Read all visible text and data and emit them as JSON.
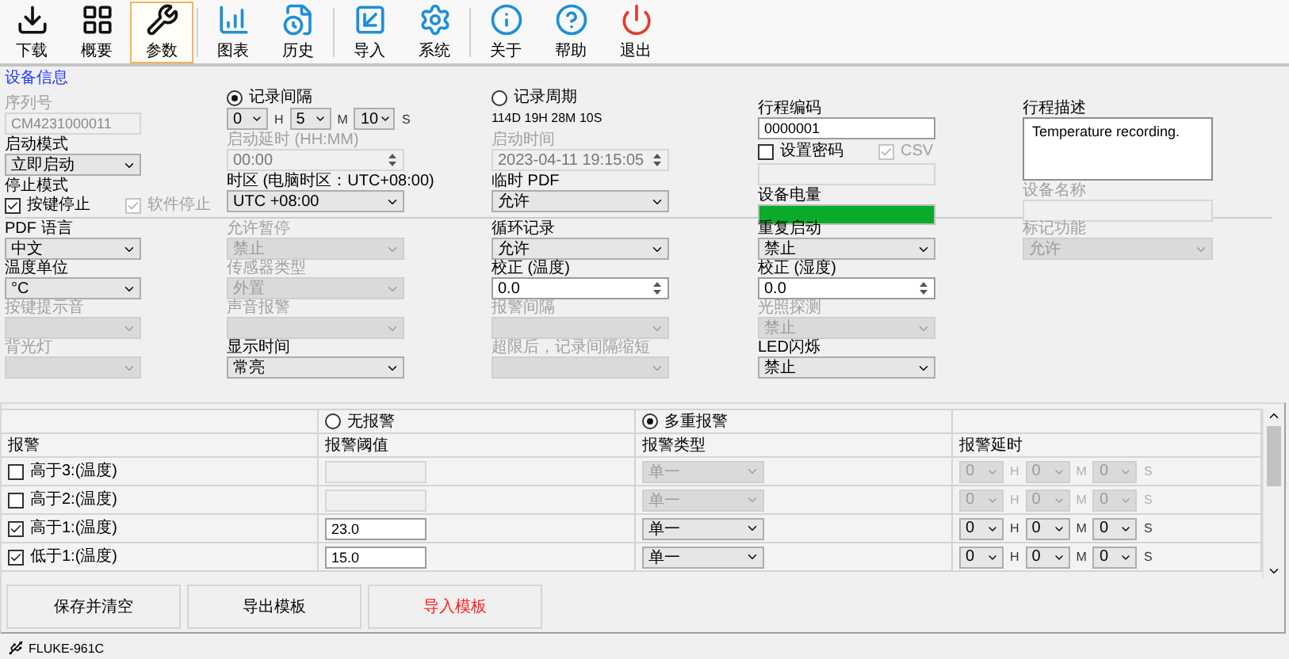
{
  "toolbar": {
    "groups": [
      {
        "buttons": [
          {
            "label": "下载",
            "selected": false
          },
          {
            "label": "概要",
            "selected": false
          },
          {
            "label": "参数",
            "selected": true
          }
        ]
      },
      {
        "buttons": [
          {
            "label": "图表",
            "selected": false
          },
          {
            "label": "历史",
            "selected": false
          }
        ]
      },
      {
        "buttons": [
          {
            "label": "导入",
            "selected": false
          },
          {
            "label": "系统",
            "selected": false
          }
        ]
      },
      {
        "buttons": [
          {
            "label": "关于",
            "selected": false
          },
          {
            "label": "帮助",
            "selected": false
          },
          {
            "label": "退出",
            "selected": false
          }
        ]
      }
    ]
  },
  "section_title": "设备信息",
  "device_info": {
    "columns": [
      {
        "fields": [
          {
            "kind": "text",
            "label": "序列号",
            "value": "CM4231000011",
            "disabled": true
          },
          {
            "kind": "select",
            "label": "启动模式",
            "value": "立即启动",
            "disabled": false
          },
          {
            "kind": "checks",
            "label": "停止模式",
            "options": [
              {
                "label": "按键停止",
                "checked": true,
                "disabled": false
              },
              {
                "label": "软件停止",
                "checked": true,
                "disabled": true
              }
            ]
          }
        ]
      },
      {
        "fields": [
          {
            "kind": "radio-hms",
            "label": "记录间隔",
            "selected": true,
            "parts": [
              {
                "value": "0",
                "unit": "H"
              },
              {
                "value": "5",
                "unit": "M"
              },
              {
                "value": "10",
                "unit": "S"
              }
            ]
          },
          {
            "kind": "spin",
            "label": "启动延时 (HH:MM)",
            "value": "00:00",
            "disabled": true
          },
          {
            "kind": "select",
            "label": "时区 (电脑时区：UTC+08:00)",
            "value": "UTC +08:00",
            "disabled": false
          }
        ]
      },
      {
        "fields": [
          {
            "kind": "radio-text",
            "label": "记录周期",
            "selected": false,
            "value": "114D 19H 28M 10S"
          },
          {
            "kind": "spin",
            "label": "启动时间",
            "value": "2023-04-11 19:15:05",
            "disabled": true
          },
          {
            "kind": "select",
            "label": "临时 PDF",
            "value": "允许",
            "disabled": false
          }
        ]
      },
      {
        "fields": [
          {
            "kind": "text",
            "label": "行程编码",
            "value": "0000001",
            "disabled": false
          },
          {
            "kind": "checks",
            "options": [
              {
                "label": "设置密码",
                "checked": false,
                "disabled": false
              },
              {
                "label": "CSV",
                "checked": true,
                "disabled": true
              }
            ]
          },
          {
            "kind": "text",
            "disabled": true
          },
          {
            "kind": "meter",
            "label": "设备电量",
            "level": 1
          }
        ]
      },
      {
        "fields": [
          {
            "kind": "textarea",
            "label": "行程描述",
            "value": "Temperature recording."
          },
          {
            "kind": "text",
            "label": "设备名称",
            "disabled": true
          }
        ]
      }
    ]
  },
  "options": {
    "rows": [
      [
        {
          "kind": "select",
          "label": "PDF 语言",
          "value": "中文",
          "disabled": false
        },
        {
          "kind": "select",
          "label": "允许暂停",
          "value": "禁止",
          "disabled": true
        },
        {
          "kind": "select",
          "label": "循环记录",
          "value": "允许",
          "disabled": false
        },
        {
          "kind": "select",
          "label": "重复启动",
          "value": "禁止",
          "disabled": false
        },
        {
          "kind": "select",
          "label": "标记功能",
          "value": "允许",
          "disabled": true
        }
      ],
      [
        {
          "kind": "select",
          "label": "温度单位",
          "value": "°C",
          "disabled": false
        },
        {
          "kind": "select",
          "label": "传感器类型",
          "value": "外置",
          "disabled": true
        },
        {
          "kind": "spin",
          "label": "校正 (温度)",
          "value": "0.0",
          "disabled": false
        },
        {
          "kind": "spin",
          "label": "校正 (湿度)",
          "value": "0.0",
          "disabled": false
        }
      ],
      [
        {
          "kind": "select",
          "label": "按键提示音",
          "disabled": true
        },
        {
          "kind": "select",
          "label": "声音报警",
          "disabled": true
        },
        {
          "kind": "select",
          "label": "报警间隔",
          "disabled": true
        },
        {
          "kind": "select",
          "label": "光照探测",
          "value": "禁止",
          "disabled": true
        }
      ],
      [
        {
          "kind": "select",
          "label": "背光灯",
          "disabled": true
        },
        {
          "kind": "select",
          "label": "显示时间",
          "value": "常亮",
          "disabled": false
        },
        {
          "kind": "select",
          "label": "超限后，记录间隔缩短",
          "disabled": true
        },
        {
          "kind": "select",
          "label": "LED闪烁",
          "value": "禁止",
          "disabled": false
        }
      ]
    ]
  },
  "alarms": {
    "modes": [
      {
        "label": "无报警",
        "selected": false
      },
      {
        "label": "多重报警",
        "selected": true
      }
    ],
    "columns": [
      "报警",
      "报警阈值",
      "报警类型",
      "报警延时"
    ],
    "rows": [
      {
        "label": "高于3:(温度)",
        "checked": false,
        "type": "单一",
        "delay": [
          {
            "value": "0",
            "unit": "H"
          },
          {
            "value": "0",
            "unit": "M"
          },
          {
            "value": "0",
            "unit": "S"
          }
        ]
      },
      {
        "label": "高于2:(温度)",
        "checked": false,
        "type": "单一",
        "delay": [
          {
            "value": "0",
            "unit": "H"
          },
          {
            "value": "0",
            "unit": "M"
          },
          {
            "value": "0",
            "unit": "S"
          }
        ]
      },
      {
        "label": "高于1:(温度)",
        "checked": true,
        "threshold": "23.0",
        "type": "单一",
        "delay": [
          {
            "value": "0",
            "unit": "H"
          },
          {
            "value": "0",
            "unit": "M"
          },
          {
            "value": "0",
            "unit": "S"
          }
        ]
      },
      {
        "label": "低于1:(温度)",
        "checked": true,
        "threshold": "15.0",
        "type": "单一",
        "delay": [
          {
            "value": "0",
            "unit": "H"
          },
          {
            "value": "0",
            "unit": "M"
          },
          {
            "value": "0",
            "unit": "S"
          }
        ]
      }
    ]
  },
  "buttons": [
    {
      "label": "保存并清空",
      "kind": "normal"
    },
    {
      "label": "导出模板",
      "kind": "normal"
    },
    {
      "label": "导入模板",
      "kind": "accent"
    }
  ],
  "status_bar": {
    "device": "FLUKE-961C"
  }
}
